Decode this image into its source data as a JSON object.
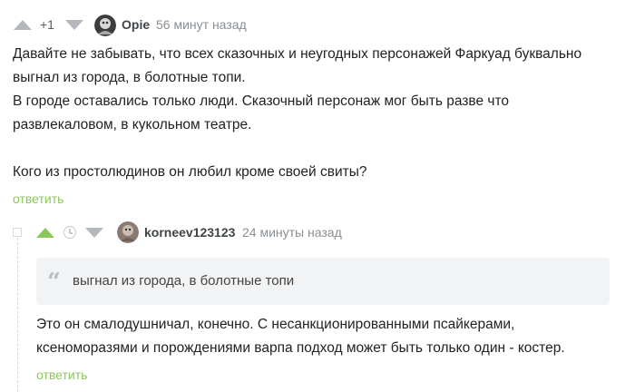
{
  "comment": {
    "rating": "+1",
    "user": "Opie",
    "time": "56 минут назад",
    "paragraphs": [
      "Давайте не забывать, что всех сказочных и неугодных персонажей Фаркуад буквально",
      "выгнал из города, в болотные топи.",
      "В городе оставались только люди. Сказочный персонаж мог быть разве что",
      "развлекаловом, в кукольном театре.",
      "Кого из простолюдинов он любил кроме своей свиты?"
    ],
    "reply_label": "ответить"
  },
  "reply": {
    "user": "korneev123123",
    "time": "24 минуты назад",
    "quote": "выгнал из города, в болотные топи",
    "paragraphs": [
      "Это он смалодушничал, конечно. С несанкционированными псайкерами,",
      "ксеноморазями и порождениями варпа подход может быть только один - костер."
    ],
    "reply_label": "ответить"
  },
  "colors": {
    "accent": "#8ac858",
    "vote": "#b4b8bc"
  },
  "icons": [
    "upvote-icon",
    "downvote-icon",
    "clock-icon",
    "quote-icon",
    "collapse-icon"
  ]
}
